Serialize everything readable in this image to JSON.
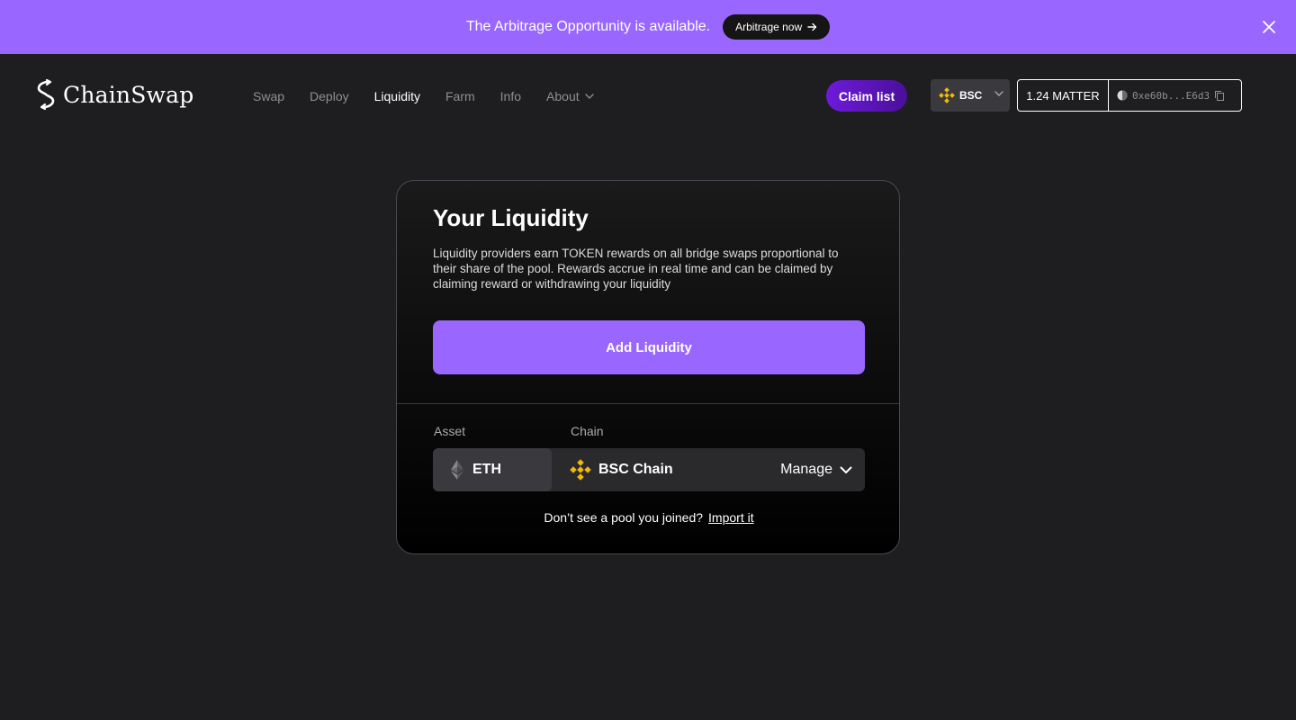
{
  "banner": {
    "text": "The Arbitrage Opportunity is available.",
    "button_label": "Arbitrage now",
    "color": "#9966ff"
  },
  "header": {
    "logo_text": "ChainSwap",
    "nav": [
      {
        "label": "Swap"
      },
      {
        "label": "Deploy"
      },
      {
        "label": "Liquidity"
      },
      {
        "label": "Farm"
      },
      {
        "label": "Info"
      },
      {
        "label": "About"
      }
    ],
    "active_nav": "Liquidity",
    "claim_label": "Claim list",
    "chain_label": "BSC",
    "balance": "1.24 MATTER",
    "address": "0xe60b...E6d3"
  },
  "card": {
    "title": "Your Liquidity",
    "description": "Liquidity providers earn TOKEN rewards on all bridge swaps proportional to their share of the pool. Rewards accrue in real time and can be claimed by claiming reward or withdrawing your liquidity",
    "add_button": "Add Liquidity",
    "asset_header": "Asset",
    "chain_header": "Chain",
    "pool": {
      "asset": "ETH",
      "chain": "BSC Chain",
      "manage_label": "Manage"
    },
    "footer_text": "Don’t see a pool you joined?",
    "import_label": "Import it"
  },
  "colors": {
    "accent": "#9966ff",
    "background": "#1e1e20",
    "bnb_yellow": "#f0b90b"
  }
}
